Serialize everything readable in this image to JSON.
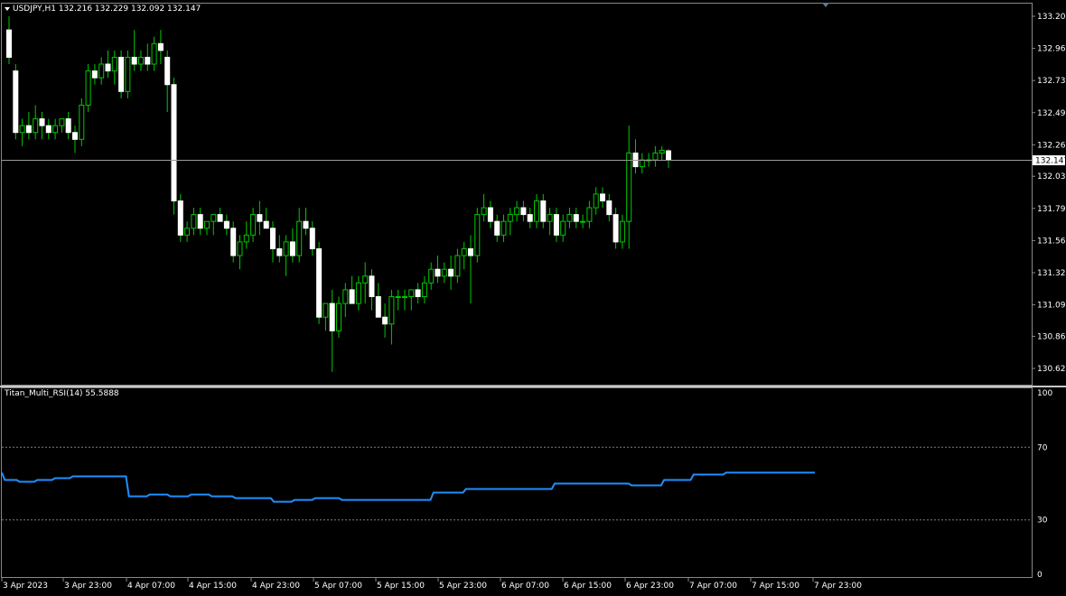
{
  "symbol_header": "USDJPY,H1  132.216 132.229 132.092 132.147",
  "current_price_label": "132.147",
  "indicator_header": "Titan_Multi_RSI(14) 55.5888",
  "colors": {
    "background": "#000000",
    "bull_body": "#000000",
    "bull_wick": "#00c800",
    "bear_body": "#ffffff",
    "rsi_line": "#1e90ff",
    "grid_dotted": "#808080",
    "separator": "#c8c8c8"
  },
  "chart_data": [
    {
      "type": "candlestick",
      "title": "USDJPY,H1",
      "ylim": [
        130.5,
        133.3
      ],
      "y_ticks": [
        "133.200",
        "132.965",
        "132.730",
        "132.495",
        "132.260",
        "132.030",
        "131.795",
        "131.560",
        "131.325",
        "131.090",
        "130.860",
        "130.625"
      ],
      "x_ticks": [
        "3 Apr 2023",
        "3 Apr 23:00",
        "4 Apr 07:00",
        "4 Apr 15:00",
        "4 Apr 23:00",
        "5 Apr 07:00",
        "5 Apr 15:00",
        "5 Apr 23:00",
        "6 Apr 07:00",
        "6 Apr 15:00",
        "6 Apr 23:00",
        "7 Apr 07:00",
        "7 Apr 15:00",
        "7 Apr 23:00"
      ],
      "current_price": 132.147,
      "ohlc": [
        [
          133.1,
          133.2,
          132.85,
          132.9
        ],
        [
          132.8,
          132.85,
          132.3,
          132.35
        ],
        [
          132.35,
          132.45,
          132.25,
          132.4
        ],
        [
          132.4,
          132.5,
          132.3,
          132.35
        ],
        [
          132.35,
          132.55,
          132.3,
          132.45
        ],
        [
          132.45,
          132.5,
          132.3,
          132.4
        ],
        [
          132.4,
          132.45,
          132.3,
          132.35
        ],
        [
          132.35,
          132.45,
          132.3,
          132.4
        ],
        [
          132.4,
          132.45,
          132.35,
          132.45
        ],
        [
          132.45,
          132.5,
          132.3,
          132.35
        ],
        [
          132.35,
          132.4,
          132.2,
          132.3
        ],
        [
          132.3,
          132.6,
          132.25,
          132.55
        ],
        [
          132.55,
          132.85,
          132.5,
          132.8
        ],
        [
          132.8,
          132.85,
          132.7,
          132.75
        ],
        [
          132.75,
          132.9,
          132.7,
          132.85
        ],
        [
          132.85,
          132.95,
          132.75,
          132.8
        ],
        [
          132.8,
          132.95,
          132.7,
          132.9
        ],
        [
          132.9,
          132.95,
          132.6,
          132.65
        ],
        [
          132.65,
          132.95,
          132.6,
          132.9
        ],
        [
          132.9,
          133.1,
          132.8,
          132.85
        ],
        [
          132.85,
          132.95,
          132.8,
          132.9
        ],
        [
          132.9,
          133.0,
          132.8,
          132.85
        ],
        [
          132.85,
          133.05,
          132.8,
          133.0
        ],
        [
          133.0,
          133.1,
          132.85,
          132.95
        ],
        [
          132.9,
          132.95,
          132.5,
          132.7
        ],
        [
          132.7,
          132.75,
          131.75,
          131.85
        ],
        [
          131.85,
          131.9,
          131.55,
          131.6
        ],
        [
          131.6,
          131.7,
          131.55,
          131.65
        ],
        [
          131.65,
          131.8,
          131.6,
          131.75
        ],
        [
          131.75,
          131.8,
          131.6,
          131.65
        ],
        [
          131.65,
          131.7,
          131.6,
          131.7
        ],
        [
          131.7,
          131.75,
          131.6,
          131.75
        ],
        [
          131.75,
          131.8,
          131.7,
          131.7
        ],
        [
          131.7,
          131.75,
          131.6,
          131.65
        ],
        [
          131.65,
          131.7,
          131.4,
          131.45
        ],
        [
          131.45,
          131.6,
          131.35,
          131.55
        ],
        [
          131.55,
          131.7,
          131.5,
          131.6
        ],
        [
          131.6,
          131.8,
          131.55,
          131.75
        ],
        [
          131.75,
          131.85,
          131.6,
          131.7
        ],
        [
          131.7,
          131.8,
          131.65,
          131.65
        ],
        [
          131.65,
          131.7,
          131.4,
          131.5
        ],
        [
          131.5,
          131.6,
          131.4,
          131.45
        ],
        [
          131.45,
          131.6,
          131.3,
          131.55
        ],
        [
          131.55,
          131.65,
          131.4,
          131.45
        ],
        [
          131.45,
          131.8,
          131.4,
          131.7
        ],
        [
          131.7,
          131.8,
          131.6,
          131.65
        ],
        [
          131.65,
          131.7,
          131.45,
          131.5
        ],
        [
          131.5,
          131.55,
          130.95,
          131.0
        ],
        [
          131.0,
          131.1,
          130.9,
          131.1
        ],
        [
          131.1,
          131.2,
          130.6,
          130.9
        ],
        [
          130.9,
          131.15,
          130.85,
          131.1
        ],
        [
          131.1,
          131.25,
          131.0,
          131.2
        ],
        [
          131.2,
          131.3,
          131.1,
          131.1
        ],
        [
          131.1,
          131.3,
          131.05,
          131.25
        ],
        [
          131.25,
          131.4,
          131.1,
          131.3
        ],
        [
          131.3,
          131.35,
          131.05,
          131.15
        ],
        [
          131.15,
          131.25,
          131.0,
          131.0
        ],
        [
          131.0,
          131.1,
          130.85,
          130.95
        ],
        [
          130.95,
          131.2,
          130.8,
          131.15
        ],
        [
          131.15,
          131.2,
          131.05,
          131.15
        ],
        [
          131.15,
          131.2,
          131.05,
          131.15
        ],
        [
          131.15,
          131.2,
          131.05,
          131.2
        ],
        [
          131.2,
          131.25,
          131.1,
          131.15
        ],
        [
          131.15,
          131.3,
          131.1,
          131.25
        ],
        [
          131.25,
          131.4,
          131.2,
          131.35
        ],
        [
          131.35,
          131.45,
          131.25,
          131.3
        ],
        [
          131.3,
          131.4,
          131.25,
          131.35
        ],
        [
          131.35,
          131.45,
          131.2,
          131.3
        ],
        [
          131.3,
          131.5,
          131.25,
          131.45
        ],
        [
          131.45,
          131.55,
          131.35,
          131.5
        ],
        [
          131.5,
          131.6,
          131.1,
          131.45
        ],
        [
          131.45,
          131.8,
          131.4,
          131.75
        ],
        [
          131.75,
          131.9,
          131.7,
          131.8
        ],
        [
          131.8,
          131.85,
          131.65,
          131.7
        ],
        [
          131.7,
          131.75,
          131.55,
          131.6
        ],
        [
          131.6,
          131.75,
          131.55,
          131.7
        ],
        [
          131.7,
          131.8,
          131.6,
          131.75
        ],
        [
          131.75,
          131.85,
          131.7,
          131.8
        ],
        [
          131.8,
          131.85,
          131.7,
          131.75
        ],
        [
          131.75,
          131.8,
          131.65,
          131.7
        ],
        [
          131.7,
          131.9,
          131.65,
          131.85
        ],
        [
          131.85,
          131.9,
          131.65,
          131.7
        ],
        [
          131.7,
          131.8,
          131.6,
          131.75
        ],
        [
          131.75,
          131.8,
          131.55,
          131.6
        ],
        [
          131.6,
          131.75,
          131.55,
          131.7
        ],
        [
          131.7,
          131.8,
          131.65,
          131.75
        ],
        [
          131.75,
          131.8,
          131.65,
          131.7
        ],
        [
          131.7,
          131.75,
          131.65,
          131.7
        ],
        [
          131.7,
          131.85,
          131.65,
          131.8
        ],
        [
          131.8,
          131.95,
          131.75,
          131.9
        ],
        [
          131.9,
          131.95,
          131.8,
          131.85
        ],
        [
          131.85,
          131.9,
          131.7,
          131.75
        ],
        [
          131.75,
          131.8,
          131.5,
          131.55
        ],
        [
          131.55,
          131.75,
          131.5,
          131.7
        ],
        [
          131.7,
          132.4,
          131.5,
          132.2
        ],
        [
          132.2,
          132.3,
          132.05,
          132.1
        ],
        [
          132.1,
          132.2,
          132.05,
          132.15
        ],
        [
          132.15,
          132.2,
          132.1,
          132.15
        ],
        [
          132.15,
          132.25,
          132.1,
          132.2
        ],
        [
          132.2,
          132.25,
          132.15,
          132.22
        ],
        [
          132.216,
          132.229,
          132.092,
          132.147
        ]
      ]
    },
    {
      "type": "line",
      "title": "Titan_Multi_RSI(14)",
      "ylim": [
        0,
        100
      ],
      "y_ticks": [
        "100",
        "70",
        "30",
        "0"
      ],
      "levels": [
        70,
        30
      ],
      "last_value": 55.5888,
      "values": [
        56,
        52,
        52,
        52,
        52,
        52,
        51,
        51,
        51,
        51,
        51,
        51,
        52,
        52,
        52,
        52,
        52,
        52,
        53,
        53,
        53,
        53,
        53,
        53,
        54,
        54,
        54,
        54,
        54,
        54,
        54,
        54,
        54,
        54,
        54,
        54,
        54,
        54,
        54,
        54,
        54,
        54,
        54,
        43,
        43,
        43,
        43,
        43,
        43,
        43,
        44,
        44,
        44,
        44,
        44,
        44,
        44,
        43,
        43,
        43,
        43,
        43,
        43,
        43,
        44,
        44,
        44,
        44,
        44,
        44,
        44,
        43,
        43,
        43,
        43,
        43,
        43,
        43,
        43,
        42,
        42,
        42,
        42,
        42,
        42,
        42,
        42,
        42,
        42,
        42,
        42,
        42,
        40,
        40,
        40,
        40,
        40,
        40,
        40,
        41,
        41,
        41,
        41,
        41,
        41,
        41,
        42,
        42,
        42,
        42,
        42,
        42,
        42,
        42,
        42,
        41,
        41,
        41,
        41,
        41,
        41,
        41,
        41,
        41,
        41,
        41,
        41,
        41,
        41,
        41,
        41,
        41,
        41,
        41,
        41,
        41,
        41,
        41,
        41,
        41,
        41,
        41,
        41,
        41,
        41,
        41,
        45,
        45,
        45,
        45,
        45,
        45,
        45,
        45,
        45,
        45,
        45,
        47,
        47,
        47,
        47,
        47,
        47,
        47,
        47,
        47,
        47,
        47,
        47,
        47,
        47,
        47,
        47,
        47,
        47,
        47,
        47,
        47,
        47,
        47,
        47,
        47,
        47,
        47,
        47,
        47,
        47,
        50,
        50,
        50,
        50,
        50,
        50,
        50,
        50,
        50,
        50,
        50,
        50,
        50,
        50,
        50,
        50,
        50,
        50,
        50,
        50,
        50,
        50,
        50,
        50,
        50,
        50,
        49,
        49,
        49,
        49,
        49,
        49,
        49,
        49,
        49,
        49,
        49,
        52,
        52,
        52,
        52,
        52,
        52,
        52,
        52,
        52,
        52,
        55,
        55,
        55,
        55,
        55,
        55,
        55,
        55,
        55,
        55,
        55,
        56,
        56,
        56,
        56,
        56,
        56,
        56,
        56,
        56,
        56,
        56,
        56,
        56,
        56,
        56,
        56,
        56,
        56,
        56,
        56,
        56,
        56,
        56,
        56,
        56,
        56,
        56,
        56,
        56,
        56,
        56
      ]
    }
  ]
}
